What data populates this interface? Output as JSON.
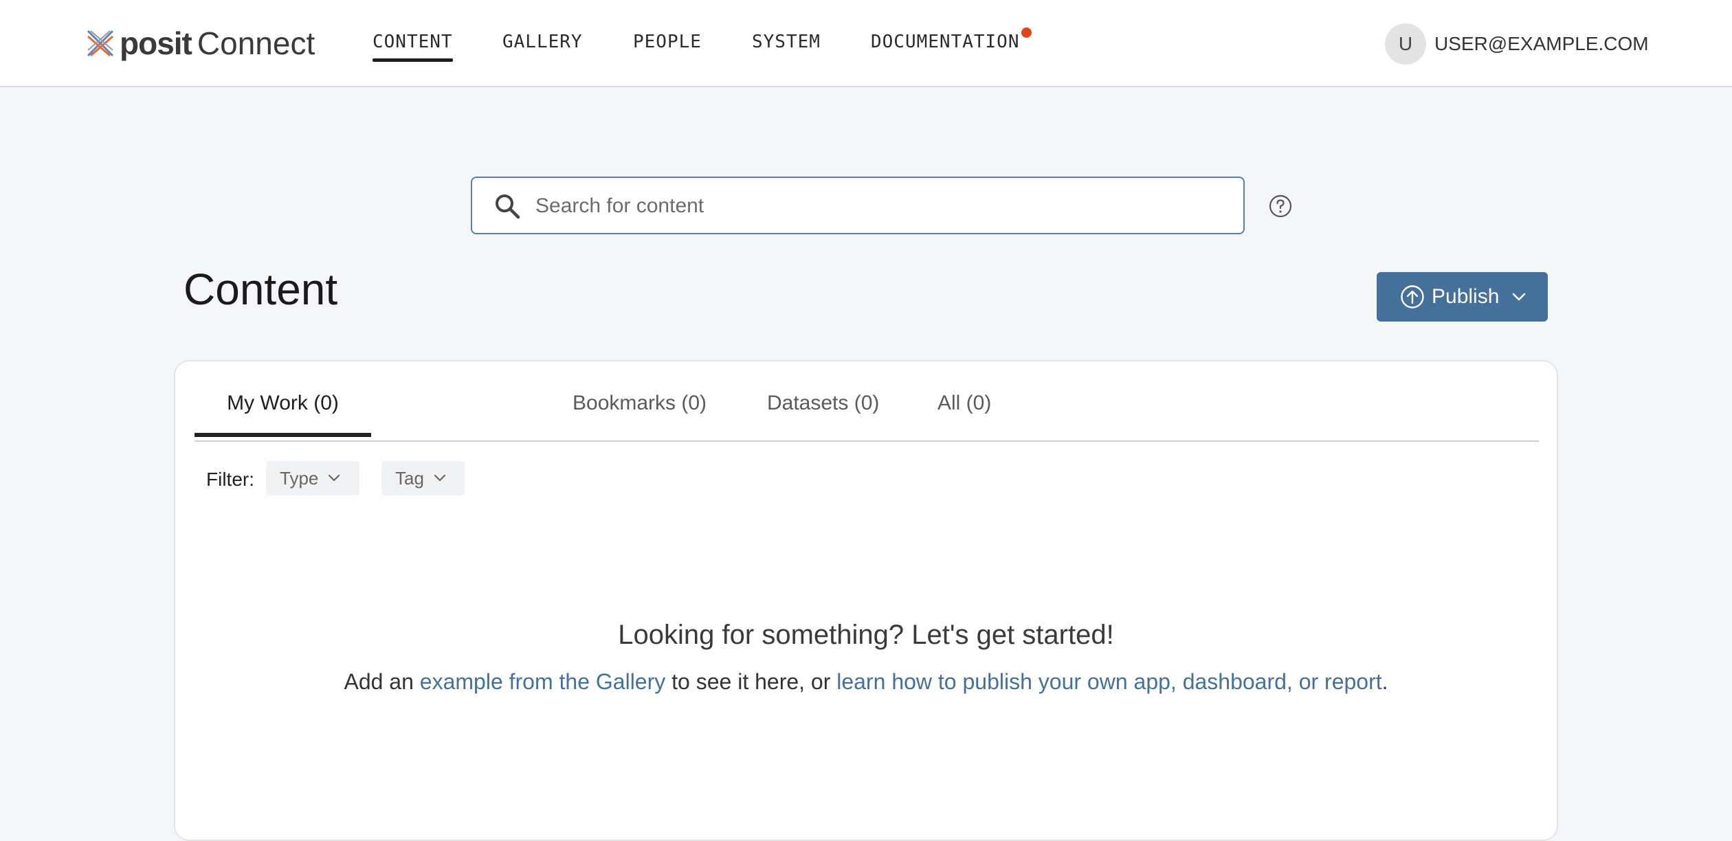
{
  "header": {
    "logo_word": "posit",
    "logo_product": "Connect",
    "nav": [
      {
        "label": "CONTENT",
        "active": true
      },
      {
        "label": "GALLERY",
        "active": false
      },
      {
        "label": "PEOPLE",
        "active": false
      },
      {
        "label": "SYSTEM",
        "active": false
      },
      {
        "label": "DOCUMENTATION",
        "active": false,
        "has_notification": true
      }
    ],
    "user": {
      "initial": "U",
      "email": "USER@EXAMPLE.COM"
    }
  },
  "search": {
    "placeholder": "Search for content",
    "value": ""
  },
  "page": {
    "title": "Content"
  },
  "publish": {
    "label": "Publish"
  },
  "tabs": [
    {
      "label": "My Work (0)",
      "active": true
    },
    {
      "label": "Bookmarks (0)",
      "active": false
    },
    {
      "label": "Datasets (0)",
      "active": false
    },
    {
      "label": "All (0)",
      "active": false
    }
  ],
  "filter": {
    "label": "Filter:",
    "type_label": "Type",
    "tag_label": "Tag"
  },
  "empty_state": {
    "title": "Looking for something? Let's get started!",
    "sub_prefix": "Add an ",
    "gallery_link": "example from the Gallery",
    "sub_middle": " to see it here, or ",
    "publish_link": "learn how to publish your own app, dashboard, or report",
    "sub_suffix": "."
  },
  "colors": {
    "accent": "#447099",
    "notification": "#e0451a",
    "background": "#f4f6f9"
  }
}
